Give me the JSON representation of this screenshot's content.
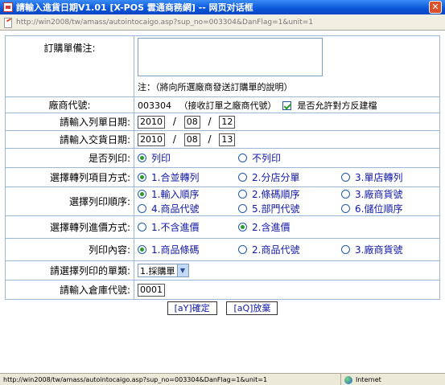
{
  "window": {
    "title": "請輸入進貨日期V1.01 [X-POS 雲通商務網] -- 网页对话框",
    "close": "✕",
    "url": "http://win2008/tw/amass/autointocaigo.asp?sup_no=003304&DanFlag=1&unit=1"
  },
  "form": {
    "note_label": "訂購單備注:",
    "note_value": "",
    "note_hint": "注：（將向所選廠商發送訂購單的說明）",
    "vendor_label": "廠商代號:",
    "vendor_code": "003304",
    "vendor_hint": "（接收訂單之廠商代號）",
    "allow_reverse_label": "是否允許對方反建檔",
    "order_date_label": "請輸入列單日期:",
    "order_date": {
      "y": "2010",
      "m": "08",
      "d": "12"
    },
    "delivery_date_label": "請輸入交貨日期:",
    "delivery_date": {
      "y": "2010",
      "m": "08",
      "d": "13"
    },
    "date_sep": "/",
    "print_label": "是否列印:",
    "print_opts": [
      "列印",
      "不列印"
    ],
    "transfer_label": "選擇轉列項目方式:",
    "transfer_opts": [
      "1.合並轉列",
      "2.分店分單",
      "3.單店轉列"
    ],
    "order_label": "選擇列印順序:",
    "order_opts": [
      "1.輸入順序",
      "2.條碼順序",
      "3.廠商貨號",
      "4.商品代號",
      "5.部門代號",
      "6.儲位順序"
    ],
    "price_label": "選擇轉列進價方式:",
    "price_opts": [
      "1.不含進價",
      "2.含進價"
    ],
    "content_label": "列印內容:",
    "content_opts": [
      "1.商品條碼",
      "2.商品代號",
      "3.廠商貨號"
    ],
    "doctype_label": "請選擇列印的單類:",
    "doctype_value": "1.採購單",
    "doctype_arrow": "▼",
    "warehouse_label": "請輸入倉庫代號:",
    "warehouse_value": "0001",
    "ok_button": "[aY]確定",
    "cancel_button": "[aQ]放棄"
  },
  "status": {
    "url": "http://win2008/tw/amass/autointocaigo.asp?sup_no=003304&DanFlag=1&unit=1",
    "zone": "Internet"
  }
}
